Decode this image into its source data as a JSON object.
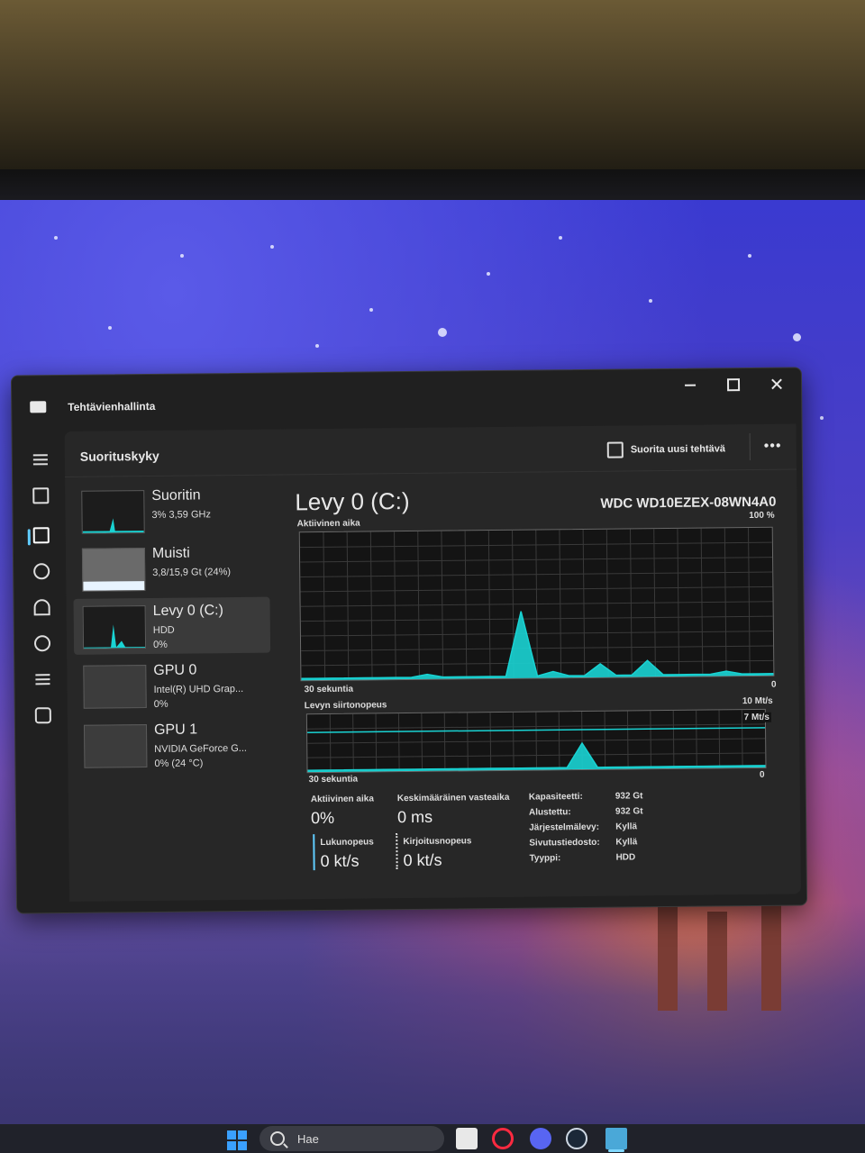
{
  "window": {
    "app_title": "Tehtävienhallinta",
    "page_title": "Suorituskyky",
    "run_task_label": "Suorita uusi tehtävä",
    "more_label": "•••"
  },
  "devices": [
    {
      "name": "Suoritin",
      "line1": "3% 3,59 GHz",
      "line2": ""
    },
    {
      "name": "Muisti",
      "line1": "3,8/15,9 Gt (24%)",
      "line2": ""
    },
    {
      "name": "Levy 0 (C:)",
      "line1": "HDD",
      "line2": "0%"
    },
    {
      "name": "GPU 0",
      "line1": "Intel(R) UHD Grap...",
      "line2": "0%"
    },
    {
      "name": "GPU 1",
      "line1": "NVIDIA GeForce G...",
      "line2": "0% (24 °C)"
    }
  ],
  "detail": {
    "title": "Levy 0 (C:)",
    "model": "WDC WD10EZEX-08WN4A0",
    "active_time_label": "Aktiivinen aika",
    "active_time_max": "100 %",
    "active_time_span": "30 sekuntia",
    "active_time_min": "0",
    "transfer_label": "Levyn siirtonopeus",
    "transfer_max": "10 Mt/s",
    "transfer_line": "7 Mt/s",
    "transfer_span": "30 sekuntia",
    "transfer_min": "0",
    "stats": {
      "active_label": "Aktiivinen aika",
      "active_value": "0%",
      "response_label": "Keskimääräinen vasteaika",
      "response_value": "0 ms",
      "read_label": "Lukunopeus",
      "read_value": "0 kt/s",
      "write_label": "Kirjoitusnopeus",
      "write_value": "0 kt/s"
    },
    "properties": [
      {
        "key": "Kapasiteetti:",
        "value": "932 Gt"
      },
      {
        "key": "Alustettu:",
        "value": "932 Gt"
      },
      {
        "key": "Järjestelmälevy:",
        "value": "Kyllä"
      },
      {
        "key": "Sivutustiedosto:",
        "value": "Kyllä"
      },
      {
        "key": "Tyyppi:",
        "value": "HDD"
      }
    ]
  },
  "taskbar": {
    "search_label": "Hae"
  },
  "chart_data": [
    {
      "type": "area",
      "title": "Aktiivinen aika",
      "xlabel": "30 sekuntia",
      "ylim": [
        0,
        100
      ],
      "x": [
        0,
        1,
        2,
        3,
        4,
        5,
        6,
        7,
        8,
        9,
        10,
        11,
        12,
        13,
        14,
        15,
        16,
        17,
        18,
        19,
        20,
        21,
        22,
        23,
        24,
        25,
        26,
        27,
        28,
        29,
        30
      ],
      "values": [
        0,
        0,
        0,
        0,
        0,
        0,
        0,
        0,
        2,
        0,
        0,
        0,
        0,
        0,
        45,
        0,
        3,
        0,
        0,
        8,
        0,
        0,
        10,
        0,
        0,
        0,
        0,
        2,
        0,
        0,
        0
      ]
    },
    {
      "type": "area",
      "title": "Levyn siirtonopeus",
      "xlabel": "30 sekuntia",
      "ylim": [
        0,
        10
      ],
      "reference_line": 7,
      "x": [
        0,
        1,
        2,
        3,
        4,
        5,
        6,
        7,
        8,
        9,
        10,
        11,
        12,
        13,
        14,
        15,
        16,
        17,
        18,
        19,
        20,
        21,
        22,
        23,
        24,
        25,
        26,
        27,
        28,
        29,
        30
      ],
      "values": [
        0,
        0,
        0,
        0,
        0,
        0,
        0,
        0,
        0,
        0,
        0,
        0,
        0,
        0,
        0,
        0,
        0,
        0,
        4.5,
        0,
        0,
        0,
        0,
        0,
        0,
        0,
        0,
        0,
        0,
        0,
        0
      ]
    }
  ],
  "colors": {
    "accent": "#60cdff",
    "graph_fill": "#19d3d3",
    "window_bg": "#202020",
    "panel_bg": "#272727"
  }
}
